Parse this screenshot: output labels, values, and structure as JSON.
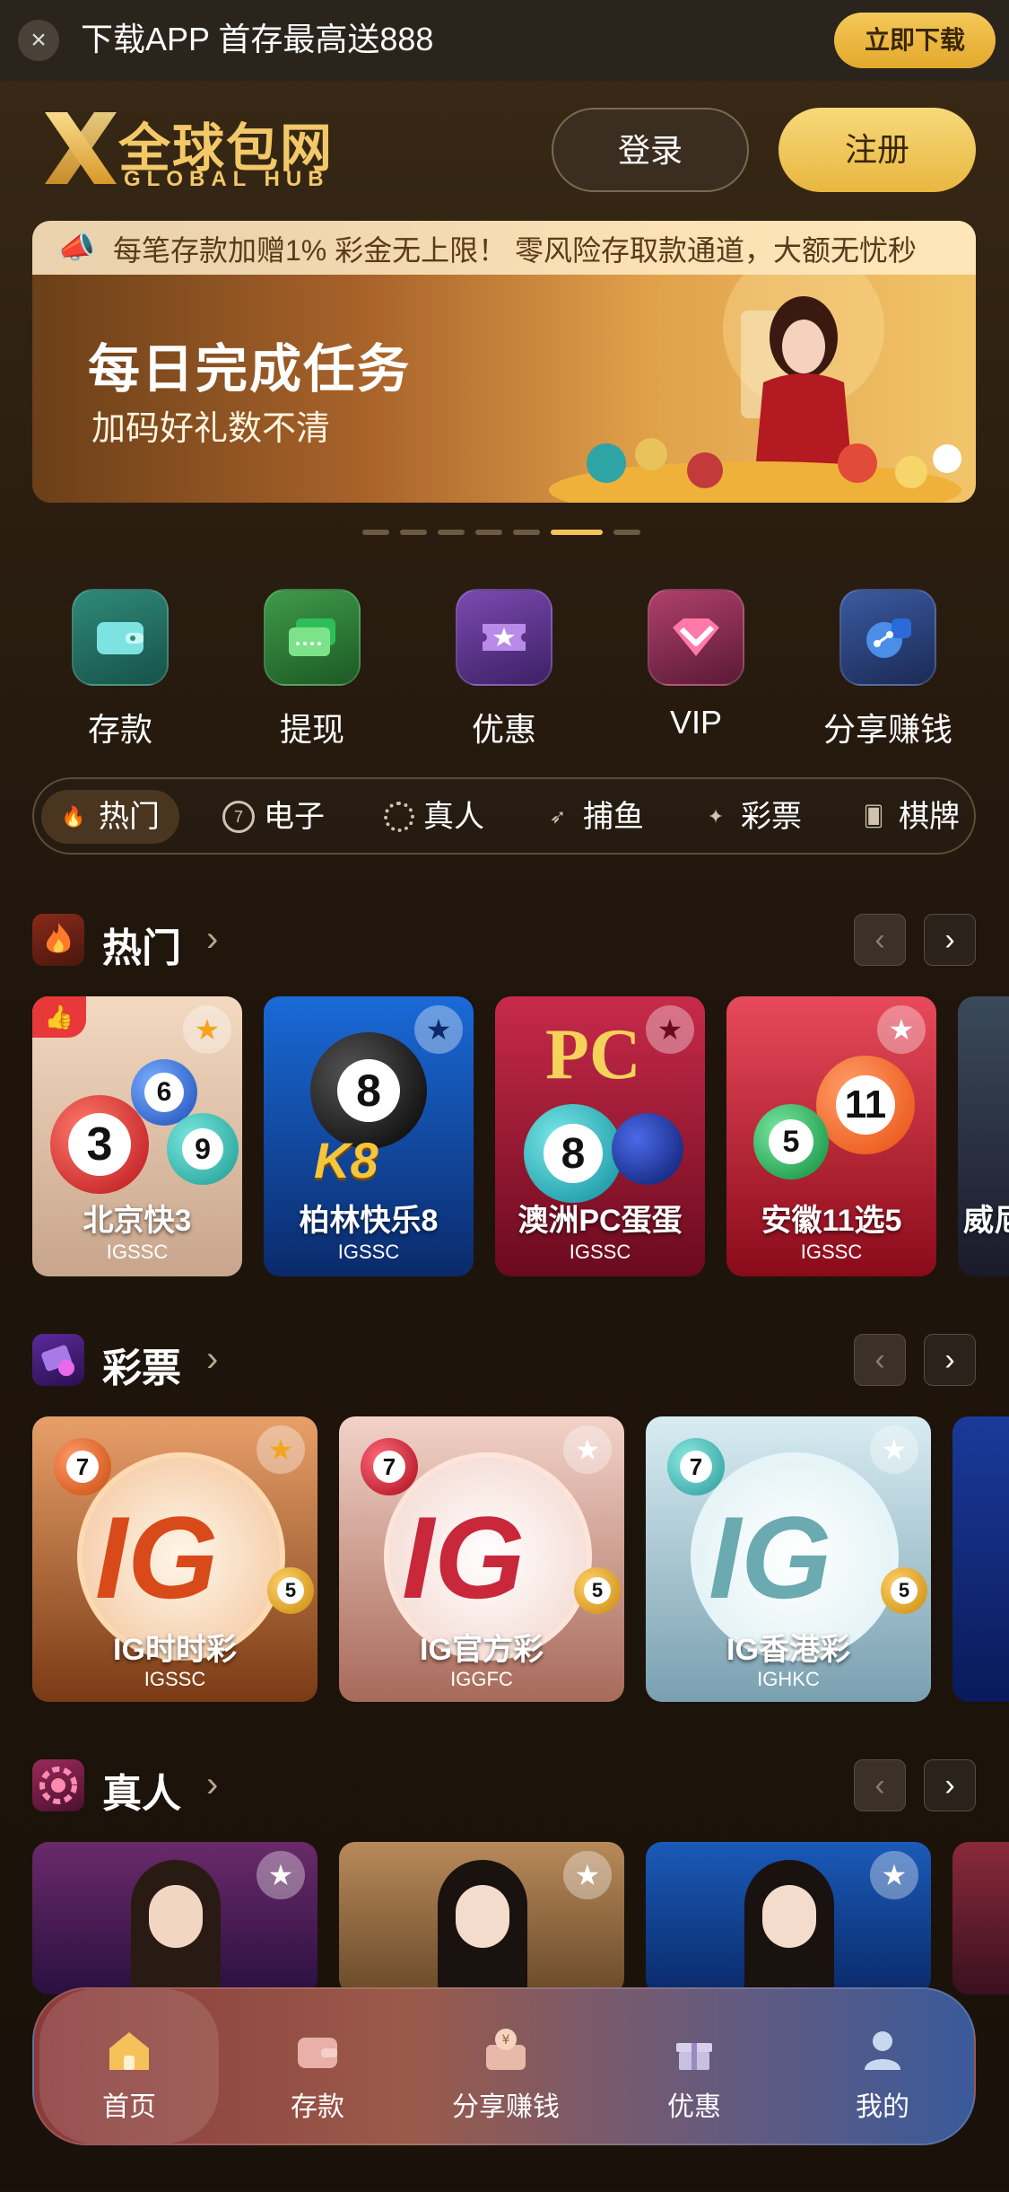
{
  "topbar": {
    "close": "×",
    "text": "下载APP 首存最高送888",
    "download_label": "立即下载"
  },
  "header": {
    "logo_cn": "全球包网",
    "logo_en": "GLOBAL HUB",
    "login_label": "登录",
    "register_label": "注册"
  },
  "banner": {
    "marquee": "每笔存款加赠1% 彩金无上限！ 零风险存取款通道，大额无忧秒",
    "title": "每日完成任务",
    "subtitle": "加码好礼数不清",
    "slide_count": 8,
    "active_slide": 6
  },
  "quick_actions": [
    {
      "label": "存款",
      "icon": "wallet-icon"
    },
    {
      "label": "提现",
      "icon": "card-icon"
    },
    {
      "label": "优惠",
      "icon": "ticket-icon"
    },
    {
      "label": "VIP",
      "icon": "diamond-icon"
    },
    {
      "label": "分享赚钱",
      "icon": "share-icon"
    }
  ],
  "categories": [
    {
      "label": "热门",
      "active": true
    },
    {
      "label": "电子"
    },
    {
      "label": "真人"
    },
    {
      "label": "捕鱼"
    },
    {
      "label": "彩票"
    },
    {
      "label": "棋牌"
    }
  ],
  "sections": {
    "hot": {
      "title": "热门",
      "items": [
        {
          "name": "北京快3",
          "sub": "IGSSC",
          "fav": true
        },
        {
          "name": "柏林快乐8",
          "sub": "IGSSC",
          "fav": false
        },
        {
          "name": "澳洲PC蛋蛋",
          "sub": "IGSSC",
          "fav": false
        },
        {
          "name": "安徽11选5",
          "sub": "IGSSC",
          "fav": false
        },
        {
          "name": "威尼",
          "sub": "",
          "fav": false
        }
      ]
    },
    "lottery": {
      "title": "彩票",
      "items": [
        {
          "name": "IG时时彩",
          "sub": "IGSSC",
          "fav": true
        },
        {
          "name": "IG官方彩",
          "sub": "IGGFC",
          "fav": false
        },
        {
          "name": "IG香港彩",
          "sub": "IGHKC",
          "fav": false
        }
      ]
    },
    "live": {
      "title": "真人"
    }
  },
  "bottom_nav": [
    {
      "label": "首页",
      "active": true
    },
    {
      "label": "存款"
    },
    {
      "label": "分享赚钱"
    },
    {
      "label": "优惠"
    },
    {
      "label": "我的"
    }
  ],
  "colors": {
    "accent_gold": "#f3c868",
    "bg_dark": "#1e140b"
  }
}
